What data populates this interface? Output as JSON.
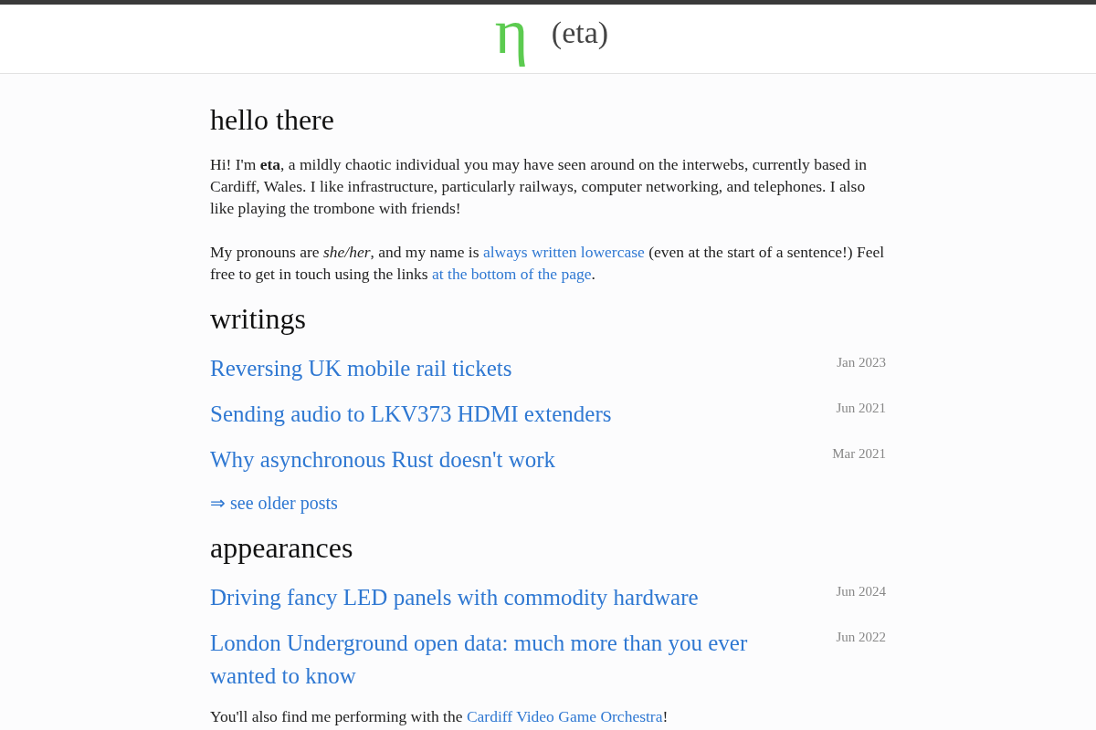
{
  "header": {
    "logo": "η",
    "title": "(eta)"
  },
  "sections": [
    {
      "heading": "hello there",
      "blocks": [
        {
          "kind": "paragraph",
          "parts": [
            {
              "kind": "text",
              "text": "Hi! I'm **eta**, a mildly chaotic individual you may have seen around on the interwebs, currently based in Cardiff, Wales. I like infrastructure, particularly railways, computer networking, and telephones. I also like playing the trombone with friends!"
            }
          ]
        },
        {
          "kind": "paragraph",
          "parts": [
            {
              "kind": "text",
              "text": "My pronouns are *she/her*, and my name is "
            },
            {
              "kind": "link",
              "text": "always written lowercase"
            },
            {
              "kind": "text",
              "text": " (even at the start of a sentence!) Feel free to get in touch using the links "
            },
            {
              "kind": "link",
              "text": "at the bottom of the page"
            },
            {
              "kind": "text",
              "text": "."
            }
          ]
        }
      ]
    },
    {
      "heading": "writings",
      "blocks": [
        {
          "kind": "post",
          "title": "Reversing UK mobile rail tickets",
          "date": "Jan 2023"
        },
        {
          "kind": "post",
          "title": "Sending audio to LKV373 HDMI extenders",
          "date": "Jun 2021"
        },
        {
          "kind": "post",
          "title": "Why asynchronous Rust doesn't work",
          "date": "Mar 2021"
        },
        {
          "kind": "more-link",
          "text": "⇒ see older posts"
        }
      ]
    },
    {
      "heading": "appearances",
      "blocks": [
        {
          "kind": "post",
          "title": "Driving fancy LED panels with commodity hardware",
          "date": "Jun 2024"
        },
        {
          "kind": "post",
          "title": "London Underground open data: much more than you ever wanted to know",
          "date": "Jun 2022"
        },
        {
          "kind": "paragraph",
          "parts": [
            {
              "kind": "text",
              "text": "You'll also find me performing with the "
            },
            {
              "kind": "link",
              "text": "Cardiff Video Game Orchestra"
            },
            {
              "kind": "text",
              "text": "!"
            }
          ]
        }
      ]
    }
  ]
}
